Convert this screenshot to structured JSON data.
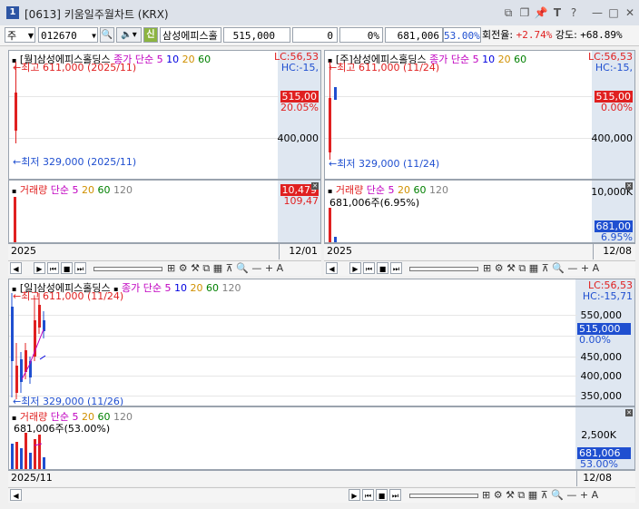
{
  "window": {
    "number": "1",
    "title": "[0613] 키움일주월차트 (KRX)"
  },
  "toolbar": {
    "market": "주",
    "code": "012670",
    "credit_badge": "신",
    "stock_name": "삼성에피스홀",
    "price": "515,000",
    "change": "0",
    "change_rate": "0%",
    "volume": "681,006",
    "volume_rate": "53.00%",
    "turnover_label": "회전율:",
    "turnover_value": "+2.74%",
    "strength_label": "강도:",
    "strength_value": "+68.89%"
  },
  "ma_legend": {
    "close_label": "종가 단순",
    "p5": "5",
    "p10": "10",
    "p20": "20",
    "p60": "60",
    "p120": "120"
  },
  "vol_legend": {
    "label": "거래량",
    "simple": "단순",
    "p5": "5",
    "p20": "20",
    "p60": "60",
    "p120": "120"
  },
  "monthly": {
    "title": "[월]삼성에피스홀딩스",
    "high_label": "최고 611,000 (2025/11)",
    "low_label": "최저 329,000 (2025/11)",
    "lc": "LC:56,53",
    "hc": "HC:-15,",
    "price_tag": "515,00",
    "pct_tag": "20.05%",
    "axis_400": "400,000",
    "vol_tag": "10,479",
    "vol_tag2": "109,47",
    "date_left": "2025",
    "date_right": "12/01"
  },
  "weekly": {
    "title": "[주]삼성에피스홀딩스",
    "high_label": "최고 611,000 (11/24)",
    "low_label": "최저 329,000 (11/24)",
    "lc": "LC:56,53",
    "hc": "HC:-15,",
    "price_tag": "515,00",
    "pct_tag": "0.00%",
    "axis_400": "400,000",
    "vol_info": "681,006주(6.95%)",
    "vol_axis": "10,000K",
    "vol_tag": "681,00",
    "vol_tag2": "6.95%",
    "date_left": "2025",
    "date_right": "12/08"
  },
  "daily": {
    "title": "[일]삼성에피스홀딩스",
    "high_label": "최고 611,000 (11/24)",
    "low_label": "최저 329,000 (11/26)",
    "lc": "LC:56,53",
    "hc": "HC:-15,71",
    "axis": [
      "550,000",
      "500,000",
      "450,000",
      "400,000",
      "350,000"
    ],
    "price_tag": "515,000",
    "pct_tag": "0.00%",
    "vol_info": "681,006주(53.00%)",
    "vol_axis": "2,500K",
    "vol_tag": "681,006",
    "vol_tag2": "53.00%",
    "date_left": "2025/11",
    "date_right": "12/08"
  },
  "colors": {
    "up": "#e02020",
    "down": "#1f4fd0",
    "ma5": "#c000c0",
    "ma10": "#0000e0",
    "ma20": "#d09000",
    "ma60": "#008000",
    "ma120": "#808080"
  }
}
